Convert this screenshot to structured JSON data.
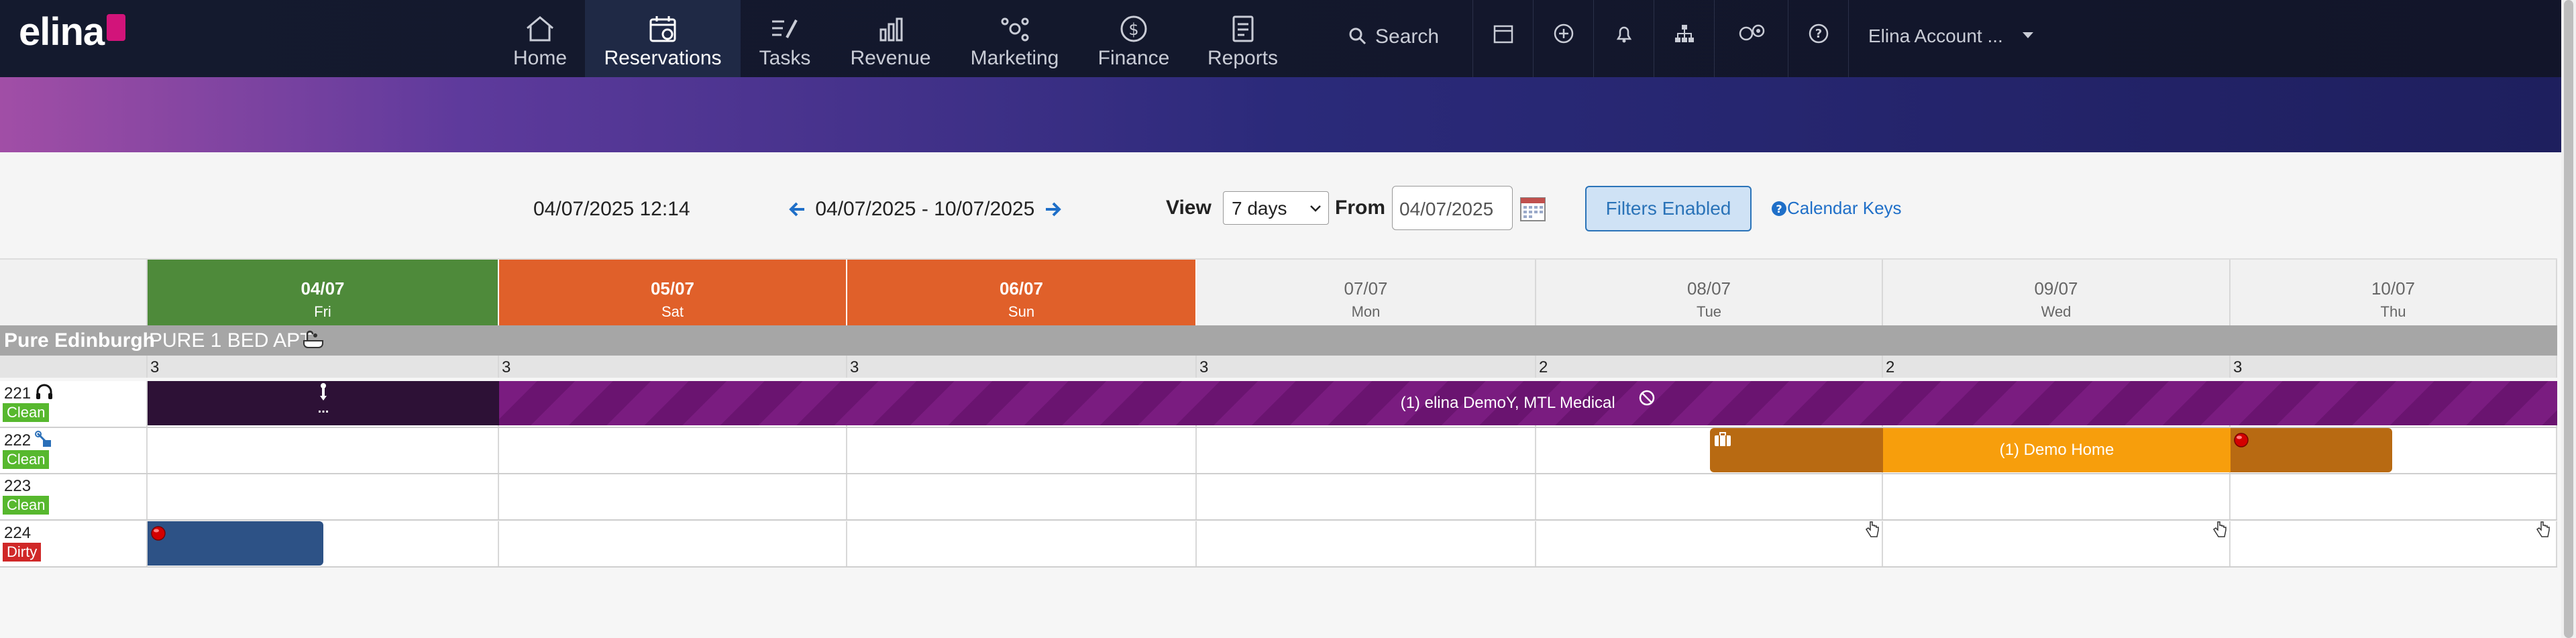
{
  "nav": {
    "logo": "elina",
    "items": [
      {
        "label": "Home",
        "icon": "home-icon"
      },
      {
        "label": "Reservations",
        "icon": "calendar-check-icon"
      },
      {
        "label": "Tasks",
        "icon": "tasks-icon"
      },
      {
        "label": "Revenue",
        "icon": "revenue-chart-icon"
      },
      {
        "label": "Marketing",
        "icon": "marketing-icon"
      },
      {
        "label": "Finance",
        "icon": "dollar-icon"
      },
      {
        "label": "Reports",
        "icon": "report-icon"
      }
    ],
    "search_label": "Search",
    "account_label": "Elina Account ..."
  },
  "toolbar": {
    "current_datetime": "04/07/2025 12:14",
    "range_label": "04/07/2025 - 10/07/2025",
    "view_label": "View",
    "view_value": "7 days",
    "from_label": "From",
    "from_value": "04/07/2025",
    "filters_button": "Filters Enabled",
    "calendar_keys": "Calendar Keys"
  },
  "calendar": {
    "days": [
      {
        "date": "04/07",
        "weekday": "Fri",
        "color": "#4e8a3a"
      },
      {
        "date": "05/07",
        "weekday": "Sat",
        "color": "#e0602a"
      },
      {
        "date": "06/07",
        "weekday": "Sun",
        "color": "#e0602a"
      },
      {
        "date": "07/07",
        "weekday": "Mon",
        "color": "#f1f1f1"
      },
      {
        "date": "08/07",
        "weekday": "Tue",
        "color": "#f1f1f1"
      },
      {
        "date": "09/07",
        "weekday": "Wed",
        "color": "#f1f1f1"
      },
      {
        "date": "10/07",
        "weekday": "Thu",
        "color": "#f1f1f1"
      }
    ],
    "group_label": "Pure Edinburgh",
    "group_type": "PURE 1 BED APT",
    "availability": [
      "3",
      "3",
      "3",
      "3",
      "2",
      "2",
      "3"
    ],
    "rooms": [
      {
        "number": "221",
        "status": "Clean",
        "status_color": "#57b82e"
      },
      {
        "number": "222",
        "status": "Clean",
        "status_color": "#57b82e"
      },
      {
        "number": "223",
        "status": "Clean",
        "status_color": "#57b82e"
      },
      {
        "number": "224",
        "status": "Dirty",
        "status_color": "#d02828"
      }
    ],
    "bookings": {
      "b221_label": "(1) elina DemoY, MTL Medical",
      "b221_dots": "...",
      "b222_label": "(1) Demo Home"
    }
  }
}
